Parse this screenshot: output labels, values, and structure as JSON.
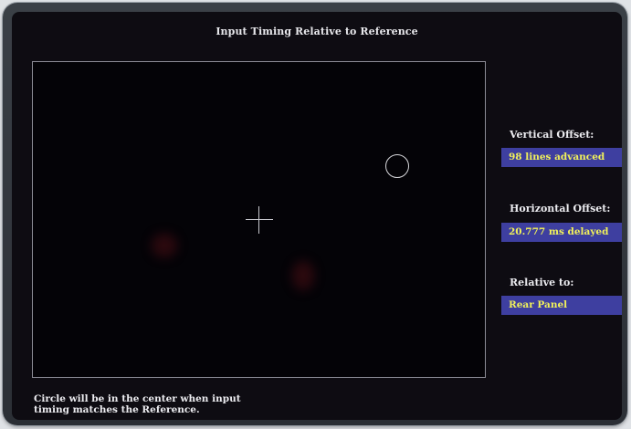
{
  "window": {
    "title": "Input Timing Relative to Reference"
  },
  "readouts": {
    "vertical_offset_label": "Vertical Offset:",
    "vertical_offset_value": "98 lines advanced",
    "horizontal_offset_label": "Horizontal Offset:",
    "horizontal_offset_value": "20.777 ms delayed",
    "relative_to_label": "Relative to:",
    "relative_to_value": "Rear Panel"
  },
  "footer": {
    "line1": "Circle will be in the center when input",
    "line2": "timing matches the Reference."
  },
  "colors": {
    "screen_background": "#0e0c12",
    "value_box": "#3e3fa0",
    "value_text": "#f1f15a",
    "label_text": "#ececf0"
  },
  "icons": {
    "center_marker": "crosshair-icon",
    "timing_marker": "circle-target-icon"
  }
}
